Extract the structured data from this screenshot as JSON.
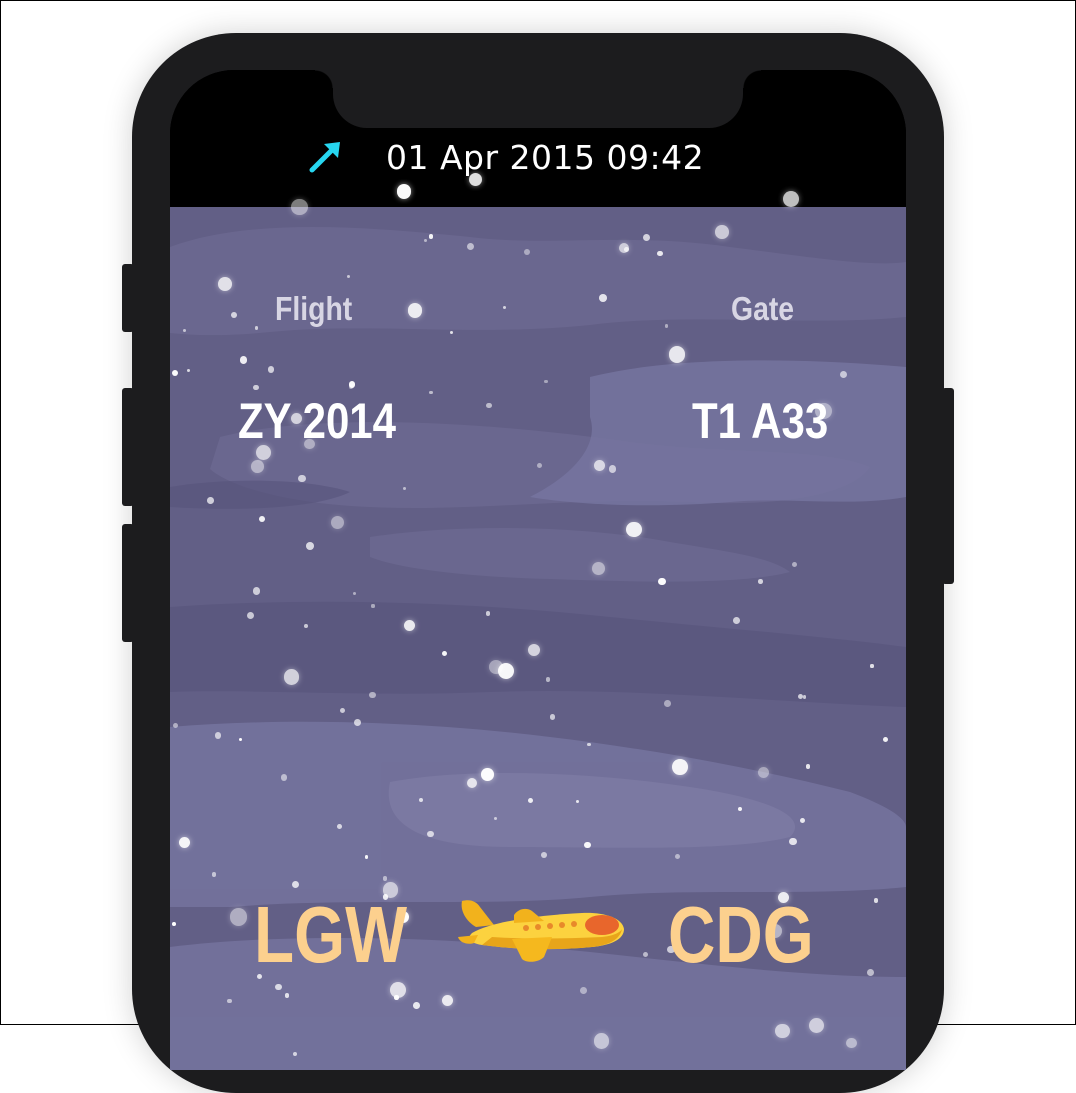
{
  "status_bar": {
    "icon": "location-arrow-icon",
    "datetime": "01 Apr 2015 09:42"
  },
  "flight_card": {
    "flight_label": "Flight",
    "flight_number": "ZY 2014",
    "gate_label": "Gate",
    "gate": "T1 A33"
  },
  "route": {
    "origin": "LGW",
    "destination": "CDG",
    "icon": "airplane-icon"
  },
  "colors": {
    "sky": "#625f86",
    "airport_code": "#fcd08e",
    "status_icon": "#27d6f0",
    "airplane": "#f7c531"
  }
}
